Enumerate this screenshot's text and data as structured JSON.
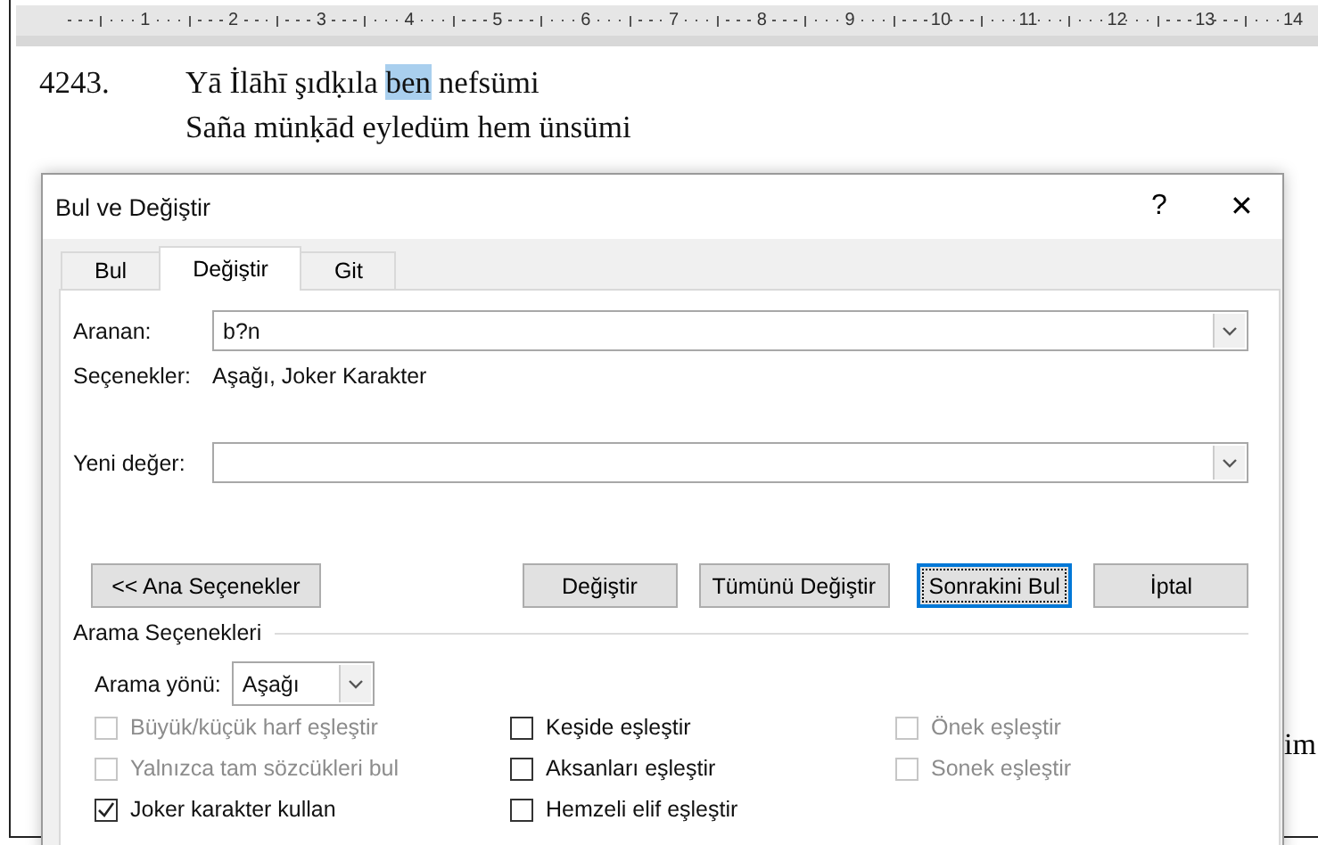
{
  "ruler": {
    "numbers": [
      "1",
      "2",
      "3",
      "4",
      "5",
      "6",
      "7",
      "8",
      "9",
      "10",
      "11",
      "12",
      "13",
      "14"
    ]
  },
  "document": {
    "verse_number": "4243.",
    "lines": [
      {
        "segments": [
          {
            "text": "Yā İlāhī şıdḳıla ",
            "highlighted": false
          },
          {
            "text": "ben",
            "highlighted": true
          },
          {
            "text": " nefsümi",
            "highlighted": false
          }
        ]
      },
      {
        "segments": [
          {
            "text": "Saña münḳād eyledüm hem ünsümi",
            "highlighted": false
          }
        ]
      }
    ],
    "partial_text": "im"
  },
  "dialog": {
    "title": "Bul ve Değiştir",
    "help": "?",
    "close": "✕",
    "tabs": [
      {
        "label": "Bul",
        "selected": false
      },
      {
        "label": "Değiştir",
        "selected": true
      },
      {
        "label": "Git",
        "selected": false
      }
    ],
    "find": {
      "label": "Aranan:",
      "value": "b?n"
    },
    "options_label": "Seçenekler:",
    "options_value": "Aşağı, Joker Karakter",
    "replace": {
      "label": "Yeni değer:"
    },
    "buttons": [
      {
        "label": "<< Ana Seçenekler",
        "focused": false
      },
      {
        "label": "Değiştir",
        "focused": false
      },
      {
        "label": "Tümünü Değiştir",
        "focused": false
      },
      {
        "label": "Sonrakini Bul",
        "focused": true
      },
      {
        "label": "İptal",
        "focused": false
      }
    ],
    "search_options": {
      "title": "Arama Seçenekleri",
      "direction_label": "Arama yönü:",
      "direction_value": "Aşağı",
      "checkboxes": [
        {
          "label": "Büyük/küçük harf eşleştir",
          "checked": false,
          "disabled": true
        },
        {
          "label": "Keşide eşleştir",
          "checked": false,
          "disabled": false
        },
        {
          "label": "Önek eşleştir",
          "checked": false,
          "disabled": true
        },
        {
          "label": "Yalnızca tam sözcükleri bul",
          "checked": false,
          "disabled": true
        },
        {
          "label": "Aksanları eşleştir",
          "checked": false,
          "disabled": false
        },
        {
          "label": "Sonek eşleştir",
          "checked": false,
          "disabled": true
        },
        {
          "label": "Joker karakter kullan",
          "checked": true,
          "disabled": false
        },
        {
          "label": "Hemzeli elif eşleştir",
          "checked": false,
          "disabled": false
        }
      ]
    }
  }
}
